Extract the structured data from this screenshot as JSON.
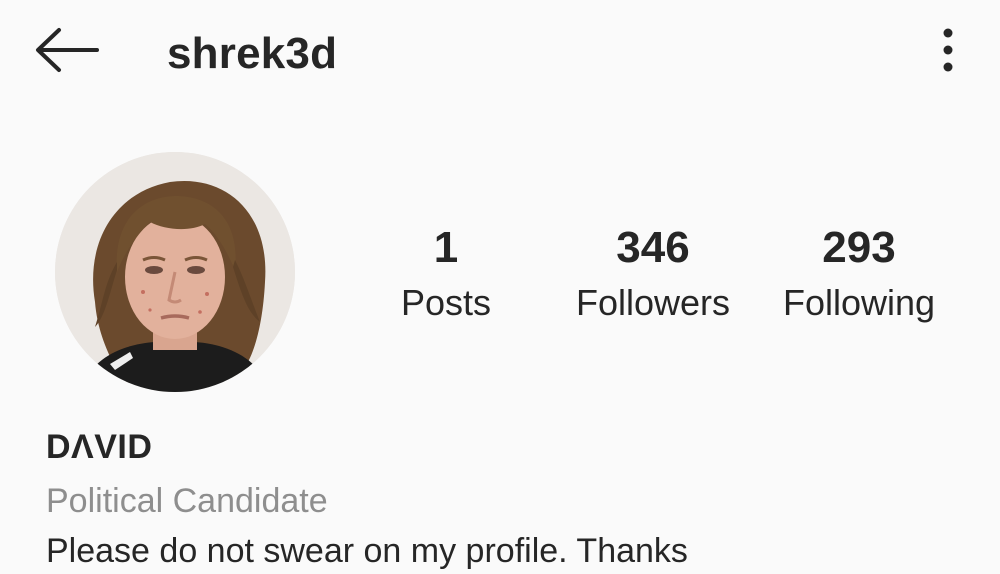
{
  "header": {
    "username": "shrek3d",
    "back_icon": "arrow-left-icon",
    "more_icon": "more-vertical-icon"
  },
  "profile": {
    "avatar_icon": "profile-photo",
    "stats": {
      "posts": {
        "value": "1",
        "label": "Posts"
      },
      "followers": {
        "value": "346",
        "label": "Followers"
      },
      "following": {
        "value": "293",
        "label": "Following"
      }
    },
    "name": "DΛVID",
    "category": "Political Candidate",
    "bio": "Please do not swear on my profile. Thanks"
  },
  "colors": {
    "background": "#fafafa",
    "text": "#262626",
    "secondary_text": "#8e8e8e"
  }
}
